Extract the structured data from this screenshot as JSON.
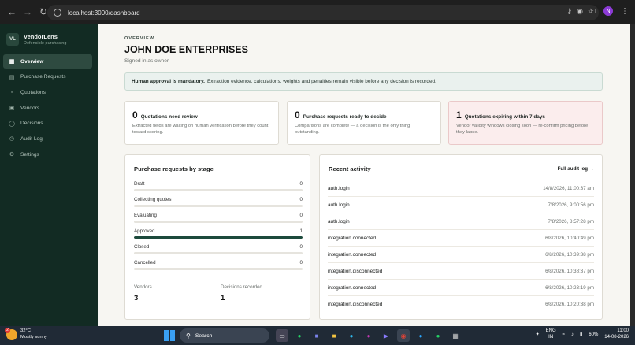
{
  "browser": {
    "url": "localhost:3000/dashboard",
    "profile_initial": "N"
  },
  "sidebar": {
    "logo_initials": "VL",
    "brand_name": "VendorLens",
    "brand_tagline": "Defensible purchasing",
    "items": [
      {
        "label": "Overview",
        "icon": "grid-icon"
      },
      {
        "label": "Purchase Requests",
        "icon": "clipboard-icon"
      },
      {
        "label": "Quotations",
        "icon": "document-icon"
      },
      {
        "label": "Vendors",
        "icon": "building-icon"
      },
      {
        "label": "Decisions",
        "icon": "check-circle-icon"
      },
      {
        "label": "Audit Log",
        "icon": "clock-icon"
      },
      {
        "label": "Settings",
        "icon": "gear-icon"
      }
    ]
  },
  "header": {
    "eyebrow": "OVERVIEW",
    "title": "JOHN DOE ENTERPRISES",
    "subtitle": "Signed in as owner"
  },
  "notice": {
    "strong": "Human approval is mandatory.",
    "text": "Extraction evidence, calculations, weights and penalties remain visible before any decision is recorded."
  },
  "stats": [
    {
      "count": "0",
      "label": "Quotations need review",
      "description": "Extracted fields are waiting on human verification before they count toward scoring."
    },
    {
      "count": "0",
      "label": "Purchase requests ready to decide",
      "description": "Comparisons are complete — a decision is the only thing outstanding."
    },
    {
      "count": "1",
      "label": "Quotations expiring within 7 days",
      "description": "Vendor validity windows closing soon — re-confirm pricing before they lapse."
    }
  ],
  "stages_card": {
    "title": "Purchase requests by stage",
    "stages": [
      {
        "label": "Draft",
        "count": 0
      },
      {
        "label": "Collecting quotes",
        "count": 0
      },
      {
        "label": "Evaluating",
        "count": 0
      },
      {
        "label": "Approved",
        "count": 1
      },
      {
        "label": "Closed",
        "count": 0
      },
      {
        "label": "Cancelled",
        "count": 0
      }
    ],
    "vendors_label": "Vendors",
    "vendors_value": "3",
    "decisions_label": "Decisions recorded",
    "decisions_value": "1"
  },
  "activity_card": {
    "title": "Recent activity",
    "link": "Full audit log →",
    "rows": [
      {
        "event": "auth.login",
        "time": "14/8/2026, 11:00:37 am"
      },
      {
        "event": "auth.login",
        "time": "7/8/2026, 9:00:56 pm"
      },
      {
        "event": "auth.login",
        "time": "7/8/2026, 8:57:28 pm"
      },
      {
        "event": "integration.connected",
        "time": "6/8/2026, 10:40:49 pm"
      },
      {
        "event": "integration.connected",
        "time": "6/8/2026, 10:39:38 pm"
      },
      {
        "event": "integration.disconnected",
        "time": "6/8/2026, 10:38:37 pm"
      },
      {
        "event": "integration.connected",
        "time": "6/8/2026, 10:23:19 pm"
      },
      {
        "event": "integration.disconnected",
        "time": "6/8/2026, 10:20:38 pm"
      }
    ]
  },
  "taskbar": {
    "temperature": "32°C",
    "weather": "Mostly sunny",
    "weather_badge": "2",
    "search": "Search",
    "lang_1": "ENG",
    "lang_2": "IN",
    "battery": "60%",
    "time": "11:00",
    "date": "14-08-2026"
  }
}
